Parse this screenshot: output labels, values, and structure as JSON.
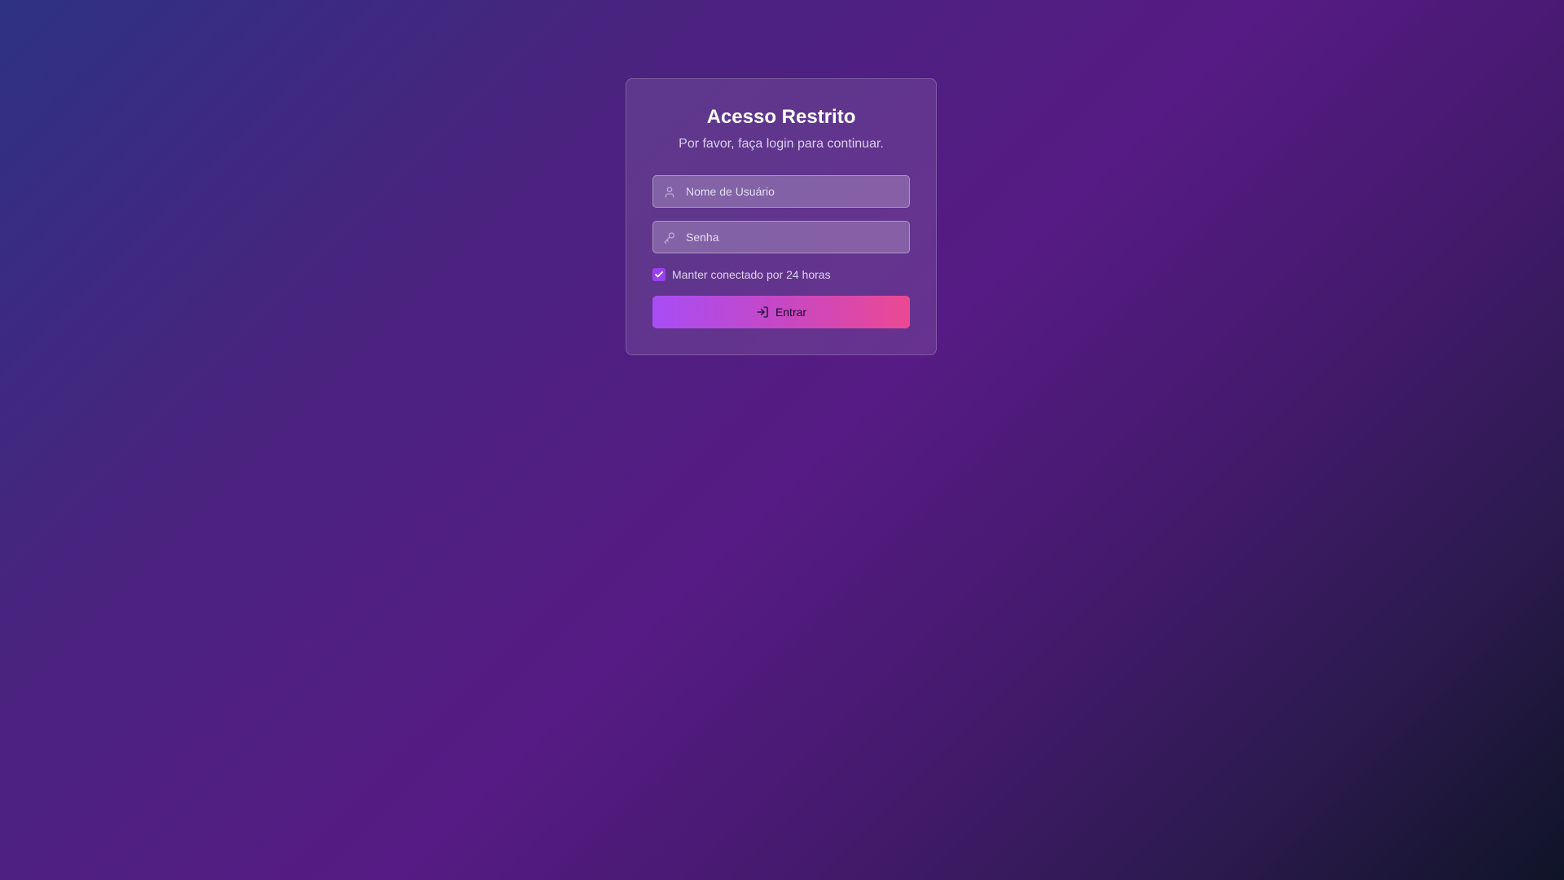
{
  "login": {
    "title": "Acesso Restrito",
    "subtitle": "Por favor, faça login para continuar.",
    "username": {
      "placeholder": "Nome de Usuário",
      "value": "",
      "icon": "user-icon"
    },
    "password": {
      "placeholder": "Senha",
      "value": "",
      "icon": "key-icon"
    },
    "remember": {
      "label": "Manter conectado por 24 horas",
      "checked": true
    },
    "submit": {
      "label": "Entrar",
      "icon": "log-in-icon"
    }
  },
  "colors": {
    "accent": "#9b3ff0",
    "button_gradient_start": "#a84df5",
    "button_gradient_end": "#ec4893",
    "background_start": "#2e3280",
    "background_mid": "#561b84",
    "background_end": "#0f1427"
  }
}
